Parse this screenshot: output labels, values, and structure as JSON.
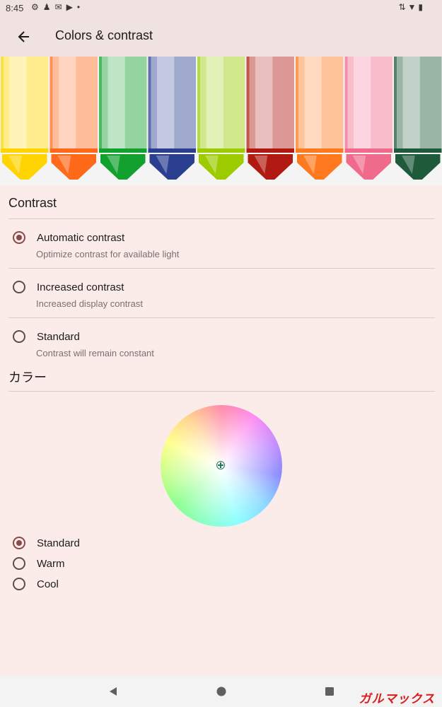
{
  "status_bar": {
    "time": "8:45"
  },
  "app_bar": {
    "title": "Colors & contrast"
  },
  "contrast": {
    "title": "Contrast",
    "options": [
      {
        "label": "Automatic contrast",
        "sublabel": "Optimize contrast for available light",
        "checked": true
      },
      {
        "label": "Increased contrast",
        "sublabel": "Increased display contrast",
        "checked": false
      },
      {
        "label": "Standard",
        "sublabel": "Contrast will remain constant",
        "checked": false
      }
    ]
  },
  "color": {
    "title": "カラー",
    "options": [
      {
        "label": "Standard",
        "checked": true
      },
      {
        "label": "Warm",
        "checked": false
      },
      {
        "label": "Cool",
        "checked": false
      }
    ]
  },
  "watermark": "ガルマックス",
  "colors": {
    "accent": "#8a4a45",
    "background": "#fbecea",
    "app_bar": "#efe2e0",
    "crayons": [
      "#ffd400",
      "#ff6a1a",
      "#12a02e",
      "#2a3f8f",
      "#9ccc00",
      "#b01a12",
      "#ff7a1f",
      "#f06a8c",
      "#1f5a3a"
    ]
  }
}
